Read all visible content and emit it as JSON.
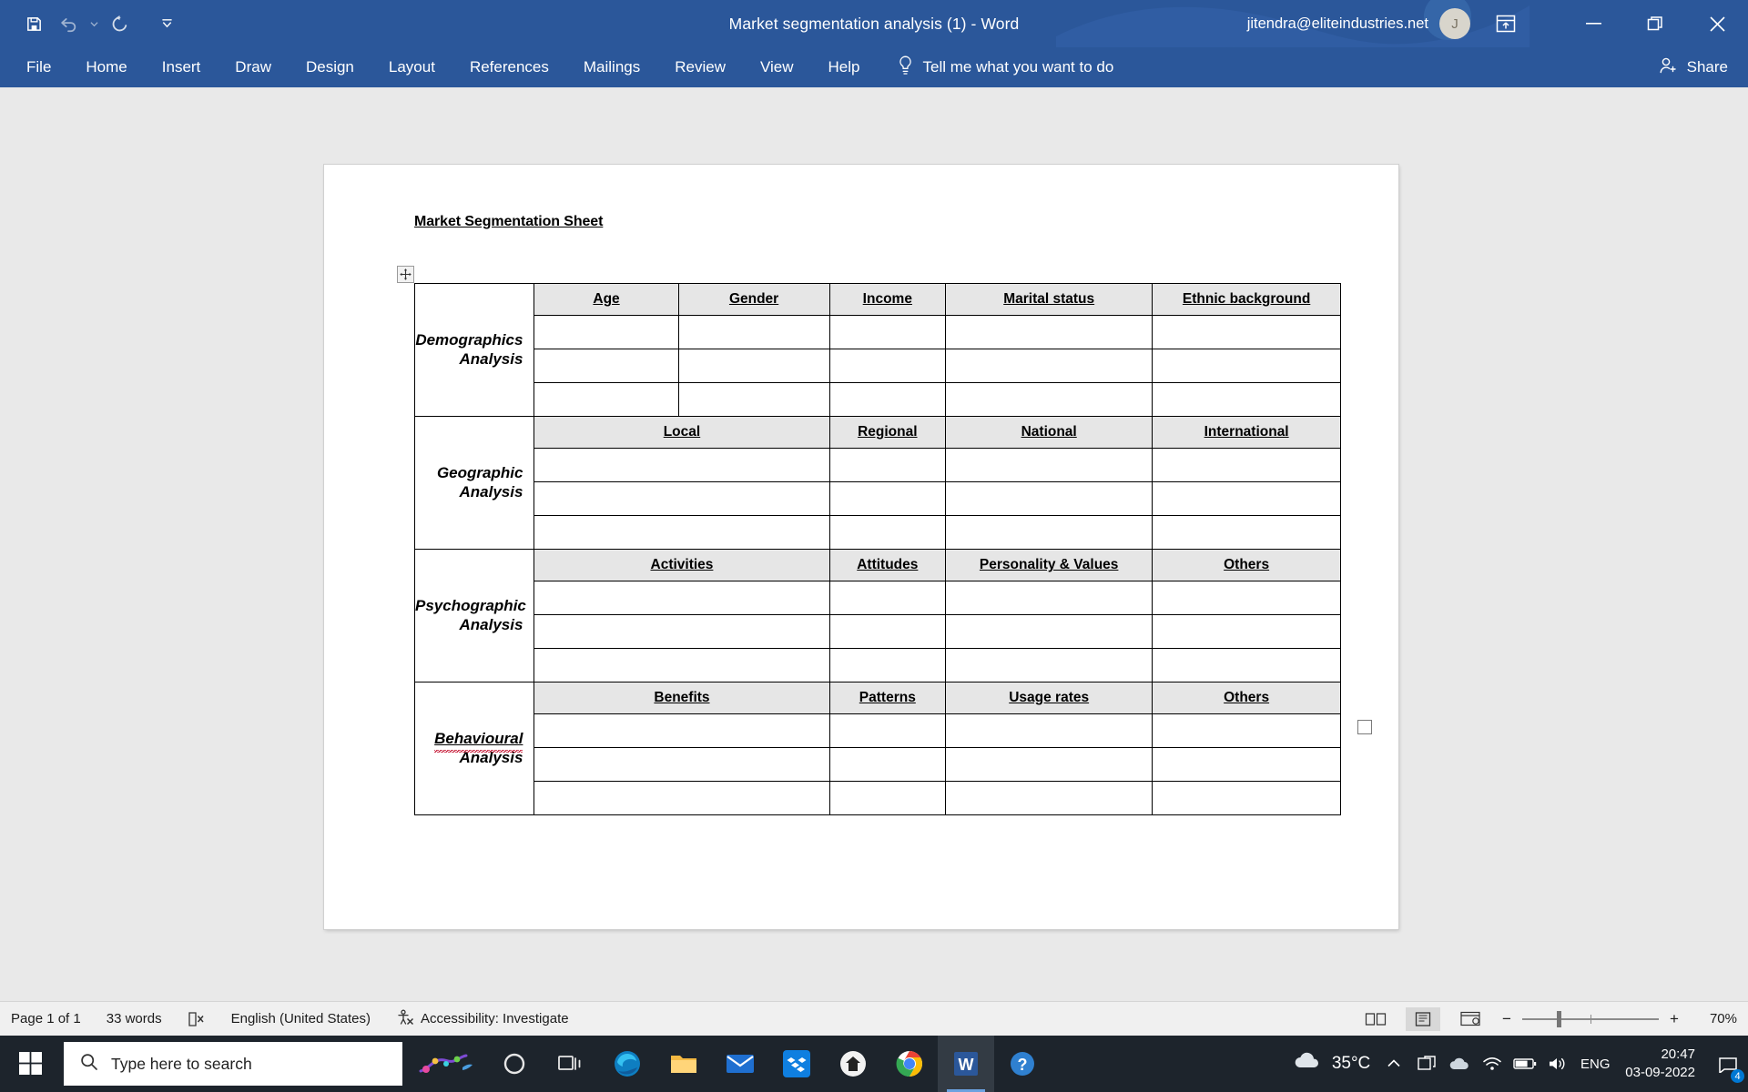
{
  "window": {
    "title": "Market segmentation analysis (1)  -  Word",
    "account_email": "jitendra@eliteindustries.net",
    "avatar_initial": "J",
    "accent_color": "#2b579a"
  },
  "quick_access": [
    {
      "name": "save-button",
      "label": "Save"
    },
    {
      "name": "undo-button",
      "label": "Undo"
    },
    {
      "name": "redo-button",
      "label": "Redo"
    },
    {
      "name": "customize-qat-button",
      "label": "Customize Quick Access Toolbar"
    }
  ],
  "window_controls": {
    "ribbon_display_options": "Ribbon Display Options",
    "minimize": "Minimize",
    "restore": "Restore Down",
    "close": "Close"
  },
  "ribbon": {
    "tabs": [
      {
        "label": "File"
      },
      {
        "label": "Home"
      },
      {
        "label": "Insert"
      },
      {
        "label": "Draw"
      },
      {
        "label": "Design"
      },
      {
        "label": "Layout"
      },
      {
        "label": "References"
      },
      {
        "label": "Mailings"
      },
      {
        "label": "Review"
      },
      {
        "label": "View"
      },
      {
        "label": "Help"
      }
    ],
    "tell_me": "Tell me what you want to do",
    "share": "Share"
  },
  "document": {
    "heading": "Market Segmentation Sheet",
    "sections": [
      {
        "label_line1": "Demographics",
        "label_line2": "Analysis",
        "misspelled": false,
        "merge_first_two": false,
        "headers": [
          "Age",
          "Gender",
          "Income",
          "Marital status",
          "Ethnic background"
        ],
        "empty_rows": 3
      },
      {
        "label_line1": "Geographic",
        "label_line2": "Analysis",
        "misspelled": false,
        "merge_first_two": true,
        "headers": [
          "Local",
          "Regional",
          "National",
          "International"
        ],
        "empty_rows": 3
      },
      {
        "label_line1": "Psychographic",
        "label_line2": "Analysis",
        "misspelled": false,
        "merge_first_two": true,
        "headers": [
          "Activities",
          "Attitudes",
          "Personality & Values",
          "Others"
        ],
        "empty_rows": 3
      },
      {
        "label_line1": "Behavioural",
        "label_line2": "Analysis",
        "misspelled": true,
        "merge_first_two": true,
        "headers": [
          "Benefits",
          "Patterns",
          "Usage rates",
          "Others"
        ],
        "empty_rows": 3
      }
    ]
  },
  "status_bar": {
    "page": "Page 1 of 1",
    "words": "33 words",
    "proofing_icon": "proofing-errors-icon",
    "language": "English (United States)",
    "accessibility": "Accessibility: Investigate",
    "views": [
      {
        "name": "read-mode-view",
        "label": "Read Mode"
      },
      {
        "name": "print-layout-view",
        "label": "Print Layout",
        "active": true
      },
      {
        "name": "web-layout-view",
        "label": "Web Layout"
      }
    ],
    "zoom_out": "−",
    "zoom_in": "+",
    "zoom_level": "70%"
  },
  "taskbar": {
    "search_placeholder": "Type here to search",
    "apps": [
      {
        "name": "taskbar-cortana",
        "label": "Cortana"
      },
      {
        "name": "taskbar-task-view",
        "label": "Task View"
      },
      {
        "name": "taskbar-edge",
        "label": "Microsoft Edge"
      },
      {
        "name": "taskbar-file-explorer",
        "label": "File Explorer"
      },
      {
        "name": "taskbar-mail",
        "label": "Mail"
      },
      {
        "name": "taskbar-dropbox",
        "label": "Dropbox"
      },
      {
        "name": "taskbar-app-home",
        "label": "Home"
      },
      {
        "name": "taskbar-chrome",
        "label": "Google Chrome"
      },
      {
        "name": "taskbar-word",
        "label": "Microsoft Word",
        "active": true
      },
      {
        "name": "taskbar-help",
        "label": "Get Help"
      }
    ],
    "weather_temp": "35°C",
    "language": "ENG",
    "time": "20:47",
    "date": "03-09-2022",
    "notification_count": "4"
  }
}
